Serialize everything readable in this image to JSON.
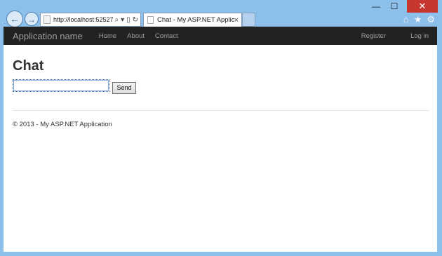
{
  "browser": {
    "url": "http://localhost:52527",
    "tab_title": "Chat - My ASP.NET Applica...",
    "nav": {
      "back_icon": "back-arrow-icon",
      "forward_icon": "forward-arrow-icon"
    },
    "caption": {
      "minimize": "—",
      "maximize": "☐",
      "close": "✕"
    },
    "right_icons": [
      "home-icon",
      "favorites-icon",
      "settings-icon"
    ]
  },
  "site": {
    "brand": "Application name",
    "nav": [
      "Home",
      "About",
      "Contact"
    ],
    "nav_right": [
      "Register",
      "Log in"
    ]
  },
  "main": {
    "heading": "Chat",
    "message_input_value": "",
    "send_label": "Send"
  },
  "footer": {
    "text": "© 2013 - My ASP.NET Application"
  }
}
